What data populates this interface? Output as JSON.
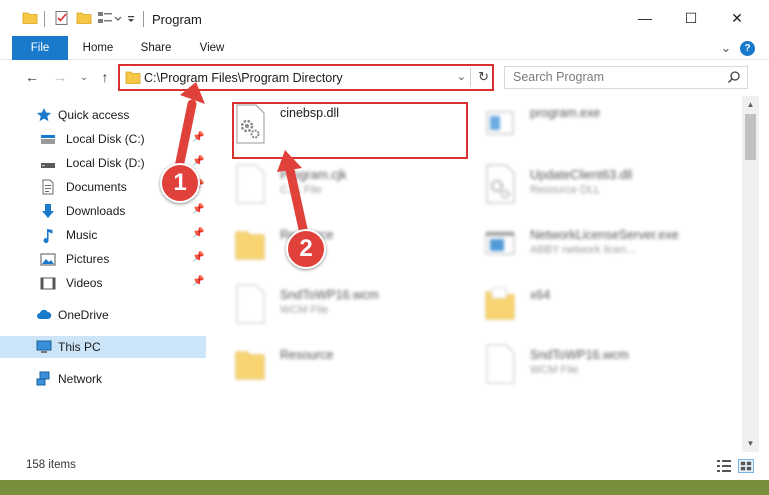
{
  "window": {
    "title": "Program",
    "controls": {
      "minimize": "—",
      "maximize": "☐",
      "close": "✕"
    }
  },
  "ribbon": {
    "tabs": [
      "File",
      "Home",
      "Share",
      "View"
    ],
    "expand": "⌄",
    "help": "?"
  },
  "nav": {
    "back": "←",
    "forward": "→",
    "recent": "⌄",
    "up": "↑",
    "address": "C:\\Program Files\\Program Directory",
    "address_dropdown": "⌄",
    "refresh": "↻",
    "search_placeholder": "Search Program"
  },
  "sidebar": {
    "quick_access": "Quick access",
    "pinned": [
      {
        "label": "Local Disk (C:)",
        "icon": "drive-icon"
      },
      {
        "label": "Local Disk (D:)",
        "icon": "drive-icon"
      },
      {
        "label": "Documents",
        "icon": "documents-icon"
      },
      {
        "label": "Downloads",
        "icon": "downloads-icon"
      },
      {
        "label": "Music",
        "icon": "music-icon"
      },
      {
        "label": "Pictures",
        "icon": "pictures-icon"
      },
      {
        "label": "Videos",
        "icon": "videos-icon"
      }
    ],
    "onedrive": "OneDrive",
    "this_pc": "This PC",
    "network": "Network",
    "pin_glyph": "📌"
  },
  "files": [
    {
      "name": "cinebsp.dll",
      "type": "",
      "icon": "dll-gear-icon",
      "highlight": true
    },
    {
      "name": "program.exe",
      "type": "",
      "icon": "exe-icon"
    },
    {
      "name": "Program.cjk",
      "type": "CJK File",
      "icon": "generic-file-icon"
    },
    {
      "name": "UpdateClient63.dll",
      "type": "Resource DLL",
      "icon": "dll-gear-icon"
    },
    {
      "name": "Resource",
      "type": "",
      "icon": "folder-icon"
    },
    {
      "name": "NetworkLicenseServer.exe",
      "type": "ABBY network licen...",
      "icon": "exe-window-icon"
    },
    {
      "name": "SndToWP16.wcm",
      "type": "WCM File",
      "icon": "generic-file-icon"
    },
    {
      "name": "x64",
      "type": "",
      "icon": "folder-icon"
    },
    {
      "name": "Resource",
      "type": "",
      "icon": "folder-icon"
    },
    {
      "name": "SndToWP16.wcm",
      "type": "WCM File",
      "icon": "generic-file-icon"
    }
  ],
  "status": {
    "item_count": "158 items"
  },
  "callouts": [
    "1",
    "2"
  ],
  "colors": {
    "accent": "#1979ca",
    "highlight": "#d9312f",
    "selection": "#cce4f7",
    "folder": "#f6c744"
  }
}
